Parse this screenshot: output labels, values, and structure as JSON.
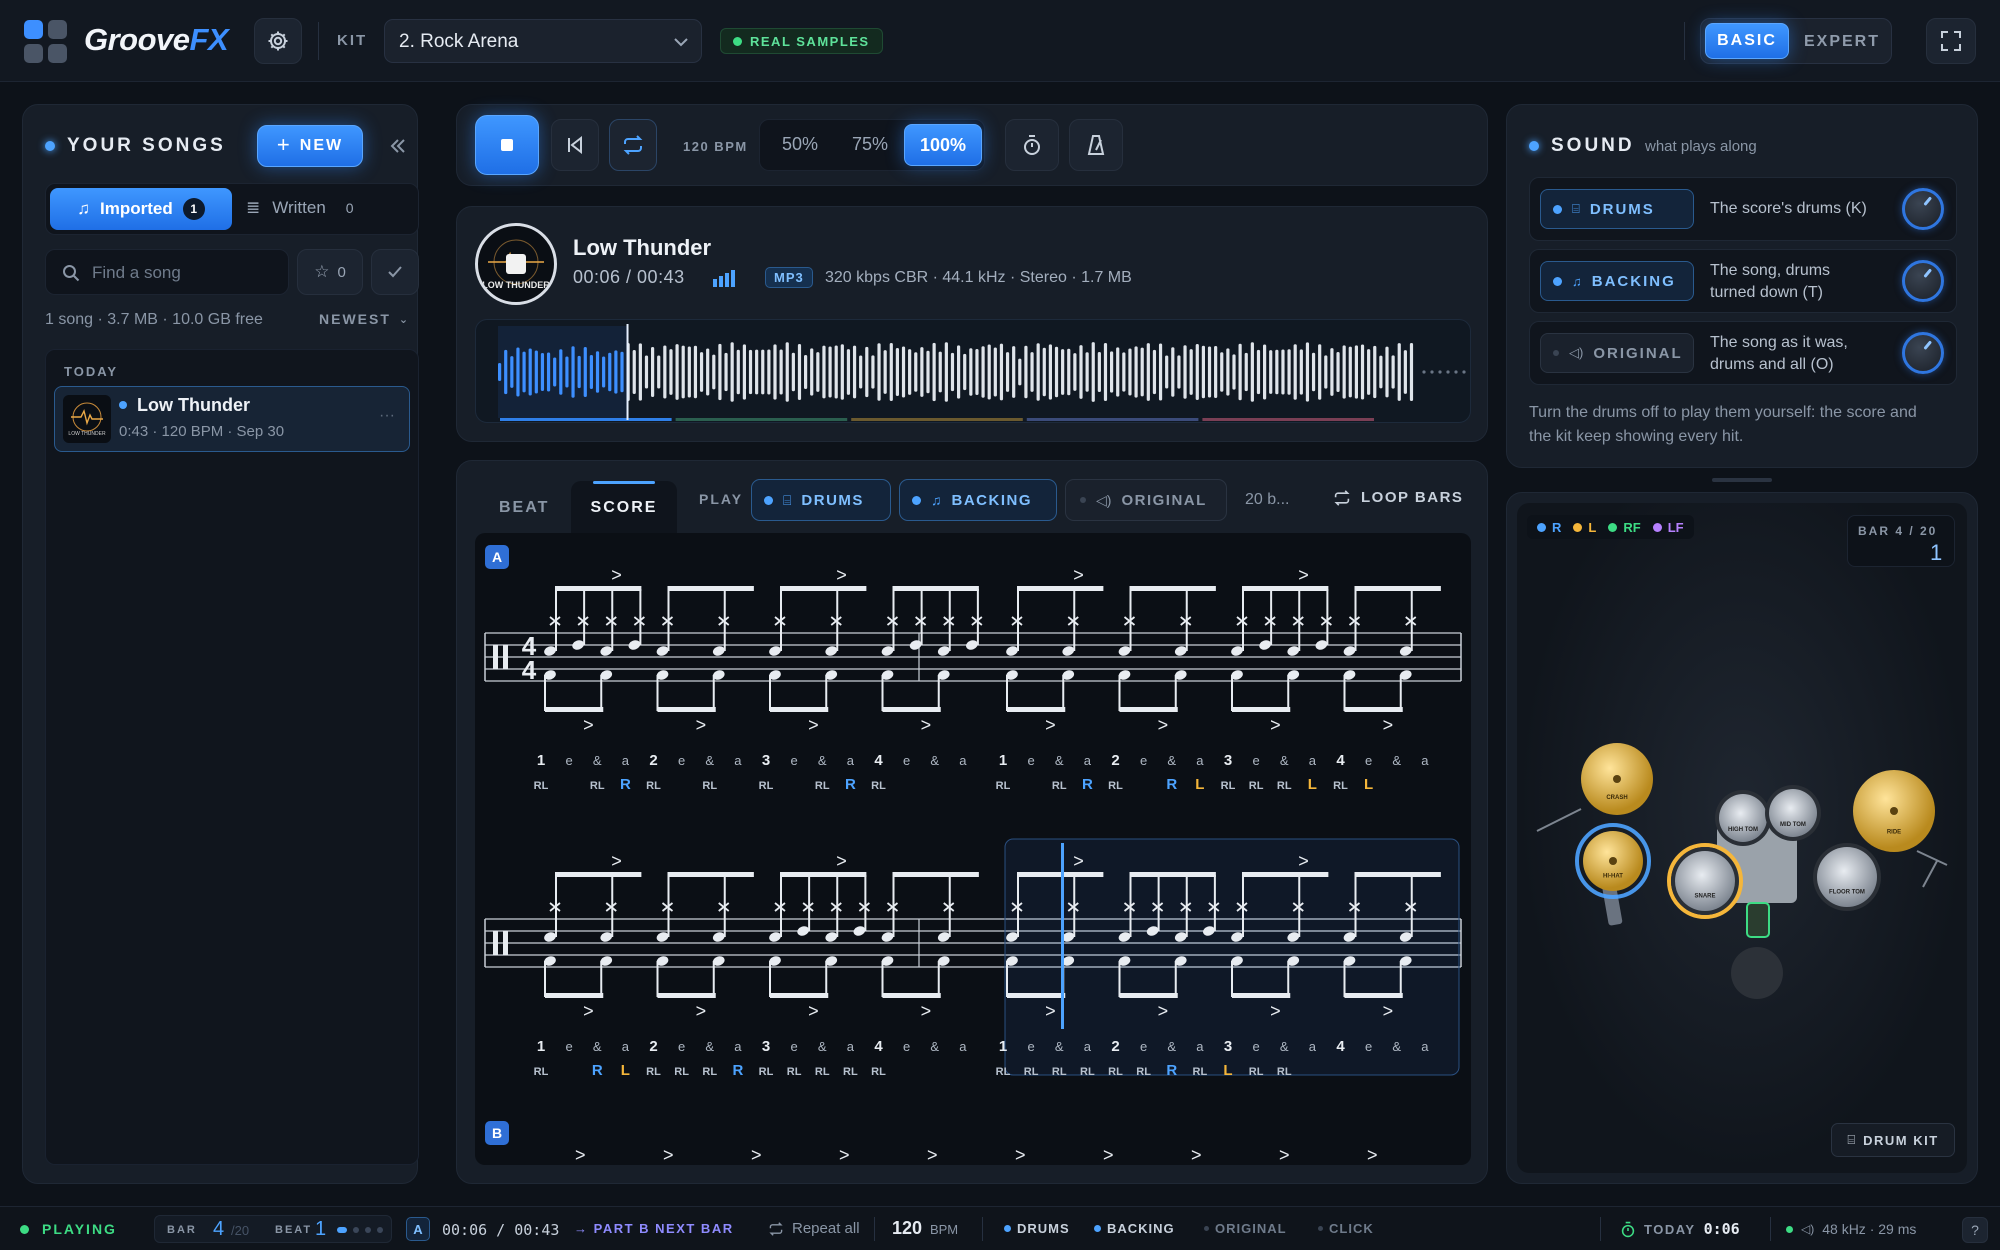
{
  "app": {
    "name_a": "Groove",
    "name_b": "FX"
  },
  "header": {
    "kit_label": "KIT",
    "kit_value": "2. Rock Arena",
    "real_samples": "REAL SAMPLES",
    "mode_basic": "BASIC",
    "mode_expert": "EXPERT"
  },
  "songs": {
    "title": "YOUR SONGS",
    "new_label": "NEW",
    "tab_imported": "Imported",
    "tab_imported_count": "1",
    "tab_written": "Written",
    "tab_written_count": "0",
    "search_placeholder": "Find a song",
    "fav_count": "0",
    "storage": "1 song · 3.7 MB · 10.0 GB free",
    "sort": "NEWEST",
    "group_today": "TODAY",
    "items": [
      {
        "title": "Low Thunder",
        "meta": "0:43 · 120 BPM · Sep 30",
        "thumb": "LOW THUNDER"
      }
    ]
  },
  "transport": {
    "bpm_label": "120 BPM",
    "speeds": [
      "50%",
      "75%",
      "100%"
    ],
    "active_speed": "100%"
  },
  "track": {
    "title": "Low Thunder",
    "time": "00:06 / 00:43",
    "format": "MP3",
    "details": "320 kbps CBR · 44.1 kHz · Stereo · 1.7 MB",
    "thumb": "LOW THUNDER",
    "progress": 0.14
  },
  "score_panel": {
    "tab_beat": "BEAT",
    "tab_score": "SCORE",
    "play_label": "PLAY",
    "drums": "DRUMS",
    "backing": "BACKING",
    "original": "ORIGINAL",
    "bars_short": "20 b...",
    "loop_bars": "LOOP BARS",
    "section_a": "A",
    "section_b": "B",
    "time_sig_top": "4",
    "time_sig_bottom": "4",
    "rows": [
      {
        "counts": [
          "1",
          "e",
          "&",
          "a",
          "2",
          "e",
          "&",
          "a",
          "3",
          "e",
          "&",
          "a",
          "4",
          "e",
          "&",
          "a",
          "1",
          "e",
          "&",
          "a",
          "2",
          "e",
          "&",
          "a",
          "3",
          "e",
          "&",
          "a",
          "4",
          "e",
          "&",
          "a"
        ],
        "hands": [
          "RL",
          "",
          "RL",
          "R",
          "RL",
          "",
          "RL",
          "",
          "RL",
          "",
          "RL",
          "R",
          "RL",
          "",
          "",
          "",
          "RL",
          "",
          "RL",
          "R",
          "RL",
          "",
          "R",
          "L",
          "RL",
          "RL",
          "RL",
          "L",
          "RL",
          "L",
          "",
          ""
        ]
      },
      {
        "counts": [
          "1",
          "e",
          "&",
          "a",
          "2",
          "e",
          "&",
          "a",
          "3",
          "e",
          "&",
          "a",
          "4",
          "e",
          "&",
          "a",
          "1",
          "e",
          "&",
          "a",
          "2",
          "e",
          "&",
          "a",
          "3",
          "e",
          "&",
          "a",
          "4",
          "e",
          "&",
          "a"
        ],
        "hands": [
          "RL",
          "",
          "R",
          "L",
          "RL",
          "RL",
          "RL",
          "R",
          "RL",
          "RL",
          "RL",
          "RL",
          "RL",
          "",
          "",
          "",
          "RL",
          "RL",
          "RL",
          "RL",
          "RL",
          "RL",
          "R",
          "RL",
          "L",
          "RL",
          "RL",
          "",
          "",
          "",
          "",
          ""
        ]
      }
    ]
  },
  "sound": {
    "title": "SOUND",
    "subtitle": "what plays along",
    "rows": [
      {
        "label": "DRUMS",
        "desc1": "The score's drums (K)",
        "desc2": ""
      },
      {
        "label": "BACKING",
        "desc1": "The song, drums",
        "desc2": "turned down (T)"
      },
      {
        "label": "ORIGINAL",
        "desc1": "The song as it was,",
        "desc2": "drums and all (O)"
      }
    ],
    "note1": "Turn the drums off to play them yourself: the score and",
    "note2": "the kit keep showing every hit."
  },
  "kit": {
    "legend": [
      "R",
      "L",
      "RF",
      "LF"
    ],
    "legend_colors": [
      "#4da3ff",
      "#f5b63a",
      "#3ddc84",
      "#b681ff"
    ],
    "bar_label": "BAR 4 / 20",
    "beat": "1",
    "drum_kit_btn": "DRUM KIT",
    "pieces": {
      "crash": "CRASH",
      "hihat": "HI-HAT",
      "snare": "SNARE",
      "high_tom": "HIGH TOM",
      "mid_tom": "MID TOM",
      "floor_tom": "FLOOR TOM",
      "ride": "RIDE"
    }
  },
  "status": {
    "playing": "PLAYING",
    "bar_label": "BAR",
    "bar_value": "4",
    "bar_total": "/20",
    "beat_label": "BEAT",
    "beat_value": "1",
    "section": "A",
    "time": "00:06 / 00:43",
    "next": "→ PART B NEXT BAR",
    "repeat": "Repeat all",
    "bpm_value": "120",
    "bpm_unit": "BPM",
    "drums": "DRUMS",
    "backing": "BACKING",
    "original": "ORIGINAL",
    "click": "CLICK",
    "today": "TODAY",
    "today_time": "0:06",
    "audio": "48 kHz · 29 ms",
    "help": "?"
  }
}
